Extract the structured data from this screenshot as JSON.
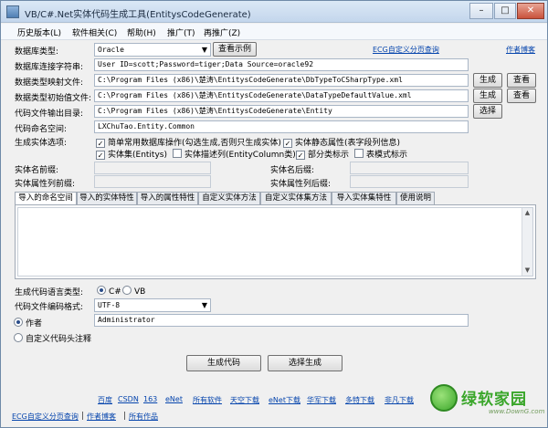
{
  "window": {
    "title": "VB/C#.Net实体代码生成工具(EntitysCodeGenerate)",
    "minimize": "–",
    "maximize": "□",
    "close": "✕"
  },
  "menu": [
    "历史版本(L)",
    "软件相关(C)",
    "帮助(H)",
    "推广(T)",
    "再推广(Z)"
  ],
  "form": {
    "db_type_label": "数据库类型:",
    "db_type_value": "Oracle",
    "view_example_button": "查看示例",
    "ecg_link": "ECG自定义分页查询",
    "author_blog_link": "作者博客",
    "conn_label": "数据库连接字符串:",
    "conn_value": "User ID=scott;Password=tiger;Data Source=oracle92",
    "map_label": "数据类型映射文件:",
    "map_value": "C:\\Program Files (x86)\\楚涛\\EntitysCodeGenerate\\DbTypeToCSharpType.xml",
    "init_label": "数据类型初始值文件:",
    "init_value": "C:\\Program Files (x86)\\楚涛\\EntitysCodeGenerate\\DataTypeDefaultValue.xml",
    "generate_button": "生成",
    "view_button": "查看",
    "output_label": "代码文件输出目录:",
    "output_value": "C:\\Program Files (x86)\\楚涛\\EntitysCodeGenerate\\Entity",
    "select_button": "选择",
    "namespace_label": "代码命名空间:",
    "namespace_value": "LXChuTao.Entity.Common",
    "options_label": "生成实体选项:",
    "options": [
      {
        "label": "简单常用数据库操作(勾选生成,否则只生成实体)",
        "checked": true
      },
      {
        "label": "实体静态属性(表字段列信息)",
        "checked": true
      },
      {
        "label": "实体集(Entitys)",
        "checked": true
      },
      {
        "label": "实体描述列(EntityColumn类)",
        "checked": false
      },
      {
        "label": "部分类标示",
        "checked": true
      },
      {
        "label": "表模式标示",
        "checked": false
      }
    ],
    "entity_prefix_label": "实体名前缀:",
    "entity_suffix_label": "实体名后缀:",
    "prop_prefix_label": "实体属性列前缀:",
    "prop_suffix_label": "实体属性列后缀:"
  },
  "tabs": [
    "导入的命名空间",
    "导入的实体特性",
    "导入的属性特性",
    "自定义实体方法",
    "自定义实体集方法",
    "导入实体集特性",
    "使用说明"
  ],
  "lower": {
    "lang_label": "生成代码语言类型:",
    "lang_options": [
      {
        "label": "C#",
        "selected": true
      },
      {
        "label": "VB",
        "selected": false
      }
    ],
    "encoding_label": "代码文件编码格式:",
    "encoding_value": "UTF-8",
    "author_radio": "作者",
    "author_value": "Administrator",
    "custom_header_radio": "自定义代码头注释",
    "generate_code_button": "生成代码",
    "select_generate_button": "选择生成"
  },
  "footer_links": [
    "百度",
    "CSDN",
    "163",
    "eNet",
    "所有软件",
    "天空下载",
    "eNet下载",
    "华军下载",
    "多特下载",
    "非凡下载"
  ],
  "status_links": [
    "ECG自定义分页查询",
    "作者博客",
    "所有作品"
  ],
  "status_sep": "|",
  "watermark": {
    "brand": "绿软家园",
    "url": "www.DownG.com"
  }
}
